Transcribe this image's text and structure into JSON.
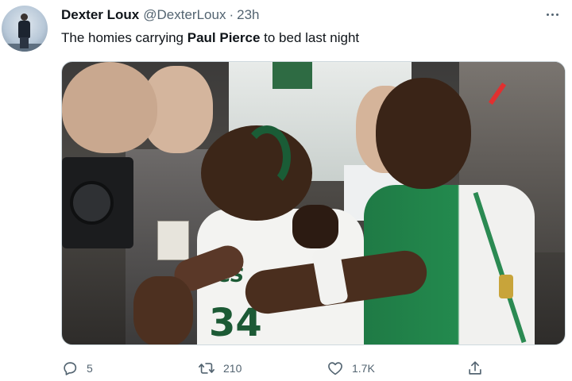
{
  "tweet": {
    "author": {
      "display_name": "Dexter Loux",
      "handle": "@DexterLoux",
      "separator": "·",
      "time": "23h"
    },
    "text": {
      "prefix": "The homies carrying ",
      "bold": "Paul Pierce",
      "suffix": " to bed last night"
    },
    "photo": {
      "jersey_word": "TICS",
      "jersey_number": "34"
    },
    "actions": {
      "replies": "5",
      "retweets": "210",
      "likes": "1.7K"
    },
    "icons": {
      "more": "more-horizontal-icon",
      "reply": "reply-icon",
      "retweet": "retweet-icon",
      "like": "heart-icon",
      "share": "share-icon"
    },
    "colors": {
      "text": "#0f1419",
      "secondary": "#536471",
      "border": "#cfd9de",
      "celtics_green": "#1f7a45"
    }
  }
}
